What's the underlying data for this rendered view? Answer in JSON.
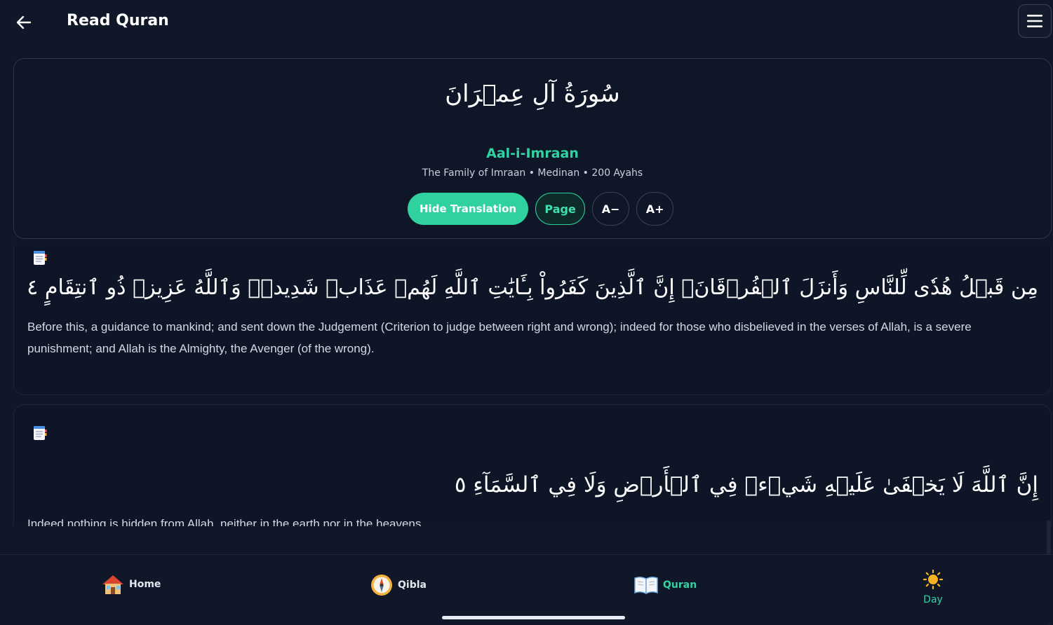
{
  "header": {
    "title": "Read Quran"
  },
  "surah": {
    "arabic_name": "سُورَةُ آلِ عِمۡرَانَ",
    "english_name": "Aal-i-Imraan",
    "meta": "The Family of Imraan • Medinan • 200 Ayahs"
  },
  "controls": {
    "hide_translation": "Hide Translation",
    "page": "Page",
    "font_decrease": "A−",
    "font_increase": "A+"
  },
  "ayahs": [
    {
      "arabic": "مِن قَبۡلُ هُدٗى لِّلنَّاسِ وَأَنزَلَ ٱلۡفُرۡقَانَۗ إِنَّ ٱلَّذِينَ كَفَرُواْ بِـَٔايَٰتِ ٱللَّهِ لَهُمۡ عَذَابٞ شَدِيدٞۗ وَٱللَّهُ عَزِيزٞ ذُو ٱنتِقَامٍ ٤",
      "translation": "Before this, a guidance to mankind; and sent down the Judgement (Criterion to judge between right and wrong); indeed for those who disbelieved in the verses of Allah, is a severe punishment; and Allah is the Almighty, the Avenger (of the wrong)."
    },
    {
      "arabic": "إِنَّ ٱللَّهَ لَا يَخۡفَىٰ عَلَيۡهِ شَيۡءٞ فِي ٱلۡأَرۡضِ وَلَا فِي ٱلسَّمَآءِ ٥",
      "translation": "Indeed nothing is hidden from Allah, neither in the earth nor in the heavens."
    }
  ],
  "nav": {
    "home": "Home",
    "qibla": "Qibla",
    "quran": "Quran",
    "day": "Day"
  },
  "colors": {
    "accent": "#2fd19f",
    "background": "#101729"
  },
  "icons": {
    "back": "arrow-left-icon",
    "menu": "hamburger-menu-icon",
    "bookmark": "bookmark-notepad-icon",
    "home": "house-icon",
    "qibla": "compass-icon",
    "quran": "open-book-icon",
    "day": "sun-icon"
  }
}
